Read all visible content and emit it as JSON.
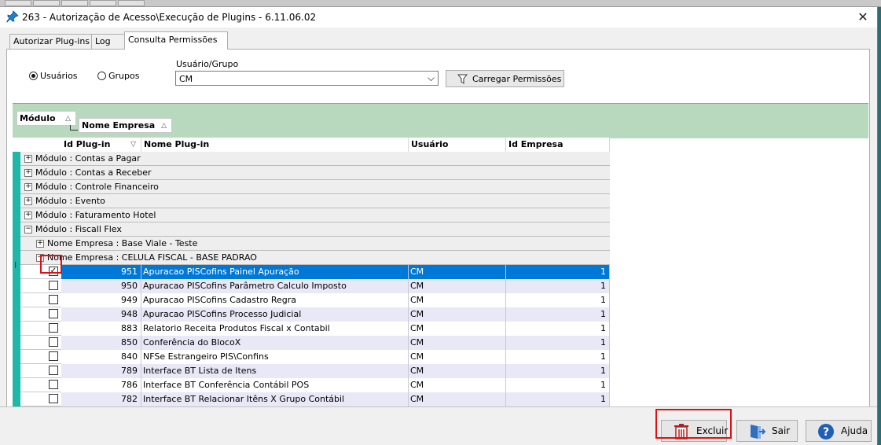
{
  "window": {
    "title": "263 - Autorização de Acesso\\Execução de Plugins - 6.11.06.02",
    "close_glyph": "✕"
  },
  "tabs": [
    {
      "label": "Autorizar Plug-ins"
    },
    {
      "label": "Log"
    },
    {
      "label": "Consulta Permissões"
    }
  ],
  "filters": {
    "radio_users": "Usuários",
    "radio_groups": "Grupos",
    "selected": "Usuários",
    "group_label": "Usuário/Grupo",
    "group_value": "CM",
    "load_button": "Carregar Permissões"
  },
  "group_band": {
    "chip1": "Módulo",
    "chip2": "Nome Empresa"
  },
  "grid": {
    "columns": [
      "Id Plug-in",
      "Nome Plug-in",
      "Usuário",
      "Id Empresa"
    ],
    "groups": [
      "Módulo : Contas a Pagar",
      "Módulo : Contas a Receber",
      "Módulo : Controle Financeiro",
      "Módulo : Evento",
      "Módulo : Faturamento Hotel",
      "Módulo : Fiscall Flex"
    ],
    "subgroups": [
      "Nome Empresa : Base Viale - Teste",
      "Nome Empresa : CELULA FISCAL - BASE PADRAO"
    ],
    "rows": [
      {
        "checked": true,
        "id": "951",
        "name": "Apuracao PISCofins Painel Apuração",
        "user": "CM",
        "emp": "1"
      },
      {
        "checked": false,
        "id": "950",
        "name": "Apuracao PISCofins Parâmetro Calculo Imposto",
        "user": "CM",
        "emp": "1"
      },
      {
        "checked": false,
        "id": "949",
        "name": "Apuracao PISCofins Cadastro Regra",
        "user": "CM",
        "emp": "1"
      },
      {
        "checked": false,
        "id": "948",
        "name": "Apuracao PISCofins Processo Judicial",
        "user": "CM",
        "emp": "1"
      },
      {
        "checked": false,
        "id": "883",
        "name": "Relatorio Receita Produtos Fiscal x Contabil",
        "user": "CM",
        "emp": "1"
      },
      {
        "checked": false,
        "id": "850",
        "name": "Conferência do BlocoX",
        "user": "CM",
        "emp": "1"
      },
      {
        "checked": false,
        "id": "840",
        "name": "NFSe Estrangeiro PIS\\Confins",
        "user": "CM",
        "emp": "1"
      },
      {
        "checked": false,
        "id": "789",
        "name": "Interface BT Lista de Itens",
        "user": "CM",
        "emp": "1"
      },
      {
        "checked": false,
        "id": "786",
        "name": "Interface BT Conferência Contábil POS",
        "user": "CM",
        "emp": "1"
      },
      {
        "checked": false,
        "id": "782",
        "name": "Interface BT Relacionar Itêns X Grupo Contábil",
        "user": "CM",
        "emp": "1"
      }
    ]
  },
  "buttons": {
    "excluir": "Excluir",
    "sair": "Sair",
    "ajuda": "Ajuda"
  },
  "colors": {
    "accent": "#0078d7",
    "indicator": "#1fb7a8",
    "group_band": "#b9d9bf",
    "highlight": "#e01010"
  }
}
